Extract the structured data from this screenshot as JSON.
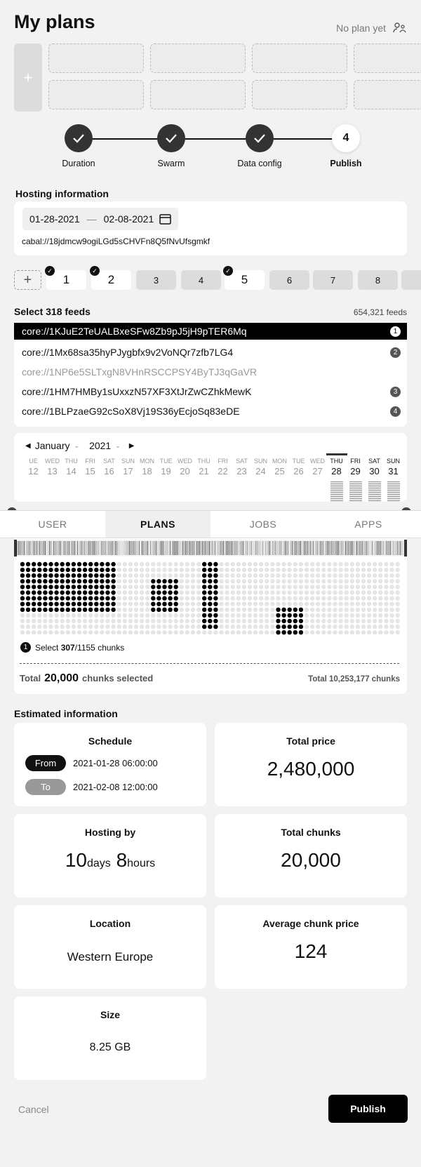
{
  "header": {
    "title": "My plans",
    "no_plan_label": "No plan yet",
    "add_symbol": "+"
  },
  "stepper": {
    "steps": [
      {
        "label": "Duration",
        "state": "done"
      },
      {
        "label": "Swarm",
        "state": "done"
      },
      {
        "label": "Data config",
        "state": "done"
      },
      {
        "label": "Publish",
        "state": "current",
        "number": "4"
      }
    ]
  },
  "hosting": {
    "title": "Hosting information",
    "date_from": "01-28-2021",
    "date_sep": "—",
    "date_to": "02-08-2021",
    "cabal_key": "cabal://18jdmcw9ogiLGd5sCHVFn8Q5fNvUfsgmkf"
  },
  "chips": [
    {
      "label": "1",
      "selected": true,
      "checked": true
    },
    {
      "label": "2",
      "selected": true,
      "checked": true
    },
    {
      "label": "3",
      "selected": false,
      "checked": false
    },
    {
      "label": "4",
      "selected": false,
      "checked": false
    },
    {
      "label": "5",
      "selected": true,
      "checked": true
    },
    {
      "label": "6",
      "selected": false,
      "checked": false
    },
    {
      "label": "7",
      "selected": false,
      "checked": false
    },
    {
      "label": "8",
      "selected": false,
      "checked": false
    }
  ],
  "feeds": {
    "title": "Select 318 feeds",
    "count": "654,321 feeds",
    "rows": [
      {
        "key": "core://1KJuE2TeUALBxeSFw8Zb9pJ5jH9pTER6Mq",
        "badge": "1",
        "state": "active"
      },
      {
        "key": "core://1Mx68sa35hyPJygbfx9v2VoNQr7zfb7LG4",
        "badge": "2",
        "state": "normal"
      },
      {
        "key": "core://1NP6e5SLTxgN8VHnRSCCPSY4ByTJ3qGaVR",
        "badge": "",
        "state": "dim"
      },
      {
        "key": "core://1HM7HMBy1sUxxzN57XF3XtJrZwCZhkMewK",
        "badge": "3",
        "state": "normal"
      },
      {
        "key": "core://1BLPzaeG92cSoX8Vj19S36yEcjoSq83eDE",
        "badge": "4",
        "state": "normal"
      }
    ]
  },
  "calendar": {
    "month": "January",
    "year": "2021",
    "days": [
      {
        "dow": "UE",
        "d": "12"
      },
      {
        "dow": "WED",
        "d": "13"
      },
      {
        "dow": "THU",
        "d": "14"
      },
      {
        "dow": "FRI",
        "d": "15"
      },
      {
        "dow": "SAT",
        "d": "16"
      },
      {
        "dow": "SUN",
        "d": "17"
      },
      {
        "dow": "MON",
        "d": "18"
      },
      {
        "dow": "TUE",
        "d": "19"
      },
      {
        "dow": "WED",
        "d": "20"
      },
      {
        "dow": "THU",
        "d": "21"
      },
      {
        "dow": "FRI",
        "d": "22"
      },
      {
        "dow": "SAT",
        "d": "23"
      },
      {
        "dow": "SUN",
        "d": "24"
      },
      {
        "dow": "MON",
        "d": "25"
      },
      {
        "dow": "TUE",
        "d": "26"
      },
      {
        "dow": "WED",
        "d": "27"
      },
      {
        "dow": "THU",
        "d": "28",
        "active": true
      },
      {
        "dow": "FRI",
        "d": "29",
        "active": true
      },
      {
        "dow": "SAT",
        "d": "30",
        "active": true
      },
      {
        "dow": "SUN",
        "d": "31",
        "active": true
      }
    ]
  },
  "tabs": [
    {
      "label": "USER"
    },
    {
      "label": "PLANS",
      "active": true
    },
    {
      "label": "JOBS"
    },
    {
      "label": "APPS"
    }
  ],
  "chunks": {
    "badge": "1",
    "select_prefix": "Select ",
    "select_count": "307",
    "select_suffix": "/1155 chunks",
    "total_label": "Total",
    "total_selected": "20,000",
    "total_selected_suffix": "chunks selected",
    "total_all": "Total 10,253,177 chunks"
  },
  "estimated": {
    "title": "Estimated information",
    "schedule": {
      "label": "Schedule",
      "from_label": "From",
      "from": "2021-01-28 06:00:00",
      "to_label": "To",
      "to": "2021-02-08 12:00:00"
    },
    "price": {
      "label": "Total price",
      "value": "2,480,000"
    },
    "hosting": {
      "label": "Hosting by",
      "days": "10",
      "days_unit": "days",
      "hours": "8",
      "hours_unit": "hours"
    },
    "chunks": {
      "label": "Total chunks",
      "value": "20,000"
    },
    "location": {
      "label": "Location",
      "value": "Western Europe"
    },
    "avg": {
      "label": "Average chunk price",
      "value": "124"
    },
    "size": {
      "label": "Size",
      "value": "8.25 GB"
    }
  },
  "footer": {
    "cancel": "Cancel",
    "publish": "Publish"
  },
  "colors": {
    "accent": "#111111",
    "bg": "#f2f2f2",
    "chip_off": "#dcdcdc"
  }
}
